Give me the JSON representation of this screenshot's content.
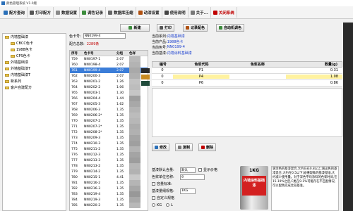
{
  "window": {
    "title": "颜色管理系统 V1.0版"
  },
  "toolbar": [
    {
      "label": "配方查询",
      "color": "#2a6fb8"
    },
    {
      "label": "打印配方",
      "color": "#555555"
    },
    {
      "label": "数据设置",
      "color": "#888888"
    },
    {
      "label": "调色记录",
      "color": "#3d8d3d"
    },
    {
      "label": "数据库压缩",
      "color": "#666666"
    },
    {
      "label": "动漆设置",
      "color": "#b05010"
    },
    {
      "label": "使用说明",
      "color": "#444444"
    },
    {
      "label": "关于...",
      "color": "#777777"
    },
    {
      "label": "关闭系统",
      "color": "#c00000"
    }
  ],
  "tree": [
    {
      "label": "内墙基础漆",
      "indent": 0
    },
    {
      "label": "CBCC色卡",
      "indent": 1
    },
    {
      "label": "1988色卡",
      "indent": 1
    },
    {
      "label": "CPS色卡",
      "indent": 1
    },
    {
      "label": "外墙基础漆",
      "indent": 0
    },
    {
      "label": "外墙基础漆T",
      "indent": 0
    },
    {
      "label": "内墙基础漆T",
      "indent": 0
    },
    {
      "label": "新系列",
      "indent": 0
    },
    {
      "label": "客户自建配方",
      "indent": 0
    }
  ],
  "search": {
    "label": "色卡号:",
    "value": "NN0199-4",
    "total_label": "配方总数:",
    "total_value": "2289条"
  },
  "table": {
    "headers": [
      "序号",
      "色卡号",
      "分组",
      "色样"
    ],
    "rows": [
      [
        "759",
        "NN0197-1",
        "2.07",
        "#b9b9b9"
      ],
      [
        "760",
        "NN0198-4",
        "2.07",
        "#b3b3b3"
      ],
      [
        "761",
        "NN0199-4",
        "2.07",
        "#a9a9a9"
      ],
      [
        "762",
        "NN0200-3",
        "2.07",
        "#b0b0b0"
      ],
      [
        "763",
        "NN0201-2",
        "1.26",
        "#c2c2c2"
      ],
      [
        "764",
        "NN0202-2",
        "1.06",
        "#bdbdbd"
      ],
      [
        "765",
        "NN0203-1",
        "1.30",
        "#c6c6c6"
      ],
      [
        "766",
        "NN0204-4",
        "1.44",
        "#9e9e9e"
      ],
      [
        "767",
        "NN0205-3",
        "1.62",
        "#a8a8a8"
      ],
      [
        "768",
        "NN0206-3",
        "1.35",
        "#b4b4b4"
      ],
      [
        "769",
        "NN0206-2*",
        "1.35",
        "#bcbcbc"
      ],
      [
        "770",
        "NN0207-2",
        "1.35",
        "#b7b7b7"
      ],
      [
        "771",
        "NN0207-2*",
        "1.35",
        "#adadad"
      ],
      [
        "772",
        "NN0208-2*",
        "1.35",
        "#b1b1b1"
      ],
      [
        "773",
        "NN0209-3",
        "1.35",
        "#a5a5a5"
      ],
      [
        "774",
        "NN0210-3",
        "1.35",
        "#9f9f9f"
      ],
      [
        "775",
        "NN0211-2",
        "1.35",
        "#b3b3b3"
      ],
      [
        "776",
        "NN0212-3",
        "1.35",
        "#a4a4a4"
      ],
      [
        "777",
        "NN0213-3",
        "1.35",
        "#9d9d9d"
      ],
      [
        "778",
        "NN0213-2",
        "1.35",
        "#b6b6b6"
      ],
      [
        "779",
        "NN0214-2",
        "1.35",
        "#b2b2b2"
      ],
      [
        "780",
        "NN0215-1",
        "4.41",
        "#c9c9c9"
      ],
      [
        "781",
        "NN0216-2",
        "1.35",
        "#b5b5b5"
      ],
      [
        "782",
        "NN0216-3",
        "1.35",
        "#a7a7a7"
      ],
      [
        "783",
        "NN0219-4",
        "1.35",
        "#989898"
      ],
      [
        "784",
        "NN0219-3",
        "1.35",
        "#a9a9a9"
      ],
      [
        "785",
        "NN0220-2",
        "1.35",
        "#b8b8b8"
      ]
    ],
    "selected_index": 2
  },
  "actions": [
    {
      "label": "新建",
      "color": "#3d8d3d"
    },
    {
      "label": "修改",
      "color": "#2a6fb8"
    },
    {
      "label": "复制",
      "color": "#777777"
    },
    {
      "label": "删除",
      "color": "#c00000"
    },
    {
      "label": "打印",
      "color": "#555555"
    },
    {
      "label": "记录配色",
      "color": "#b05010"
    },
    {
      "label": "自动机调色",
      "color": "#3d8d3d"
    }
  ],
  "info": {
    "series_label": "当前系列:",
    "series_value": "内墙基础漆",
    "product_label": "当前产品:",
    "product_value": "1988色卡",
    "code_label": "当前色号:",
    "code_value": "NN0199-4",
    "base_label": "当前基漆:",
    "base_value": "内墙涂料基础漆"
  },
  "recipe": {
    "headers": [
      "编号",
      "色浆代码",
      "色浆名称",
      "数量(g)"
    ],
    "rows": [
      {
        "no": "0",
        "code": "P1",
        "name": "",
        "qty": "0.31",
        "swatch": "#2a2a2a"
      },
      {
        "no": "0",
        "code": "P4",
        "name": "",
        "qty": "1.08",
        "swatch": "#c88a20"
      },
      {
        "no": "0",
        "code": "P6",
        "name": "",
        "qty": "0.86",
        "swatch": "#1f4a3a"
      }
    ]
  },
  "form": {
    "base_qty_label": "基漆默认含量:",
    "base_qty_value": "默认",
    "show_price_label": "显示价格",
    "unit_label": "色浆单位名称:",
    "unit_value": "g",
    "filter_label": "容量标准:",
    "base_label": "基漆量纲规格:",
    "base_value": "1KG",
    "mix_label": "自定义规格",
    "kg_label": "KG",
    "custom_label": "L"
  },
  "can": {
    "top_text": "1KG",
    "label_text": "内墙涂料基础漆"
  },
  "notes": {
    "text": "调涂色的基漆混合,大约在在0.8以上;调淡色的基漆混合,大约在0.5以下;碰撞现象的基漆基准,大约减少使用量。对于深色平均涂料的色浆时间,在15-19%之后,C类在9-1%可能存在不匹配情况,可以配色完成比较基准。"
  }
}
